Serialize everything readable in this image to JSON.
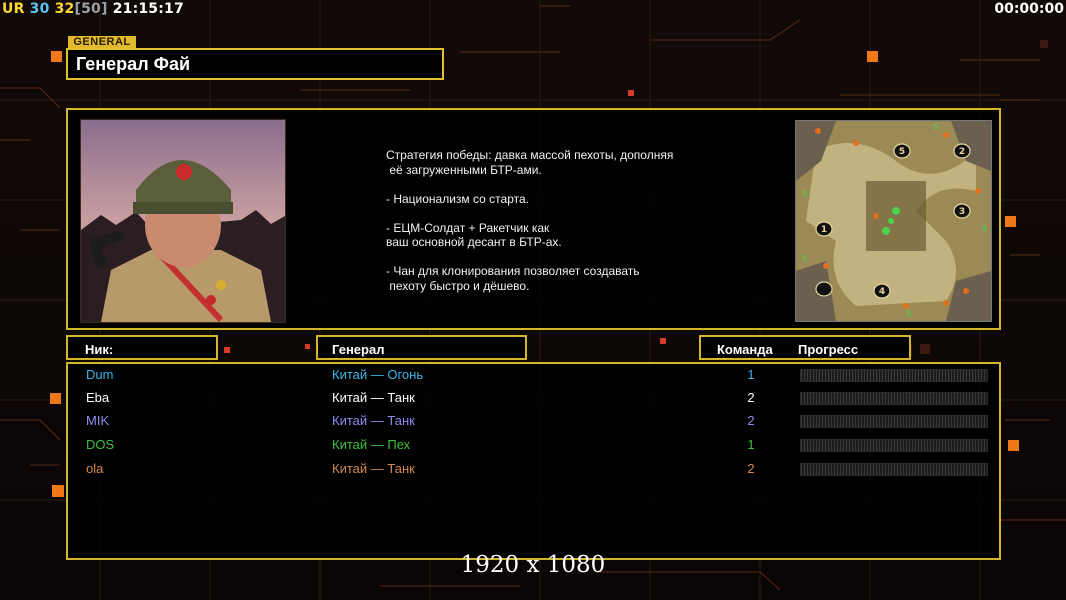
{
  "hud": {
    "ur": "UR",
    "fps": "30",
    "units": "32",
    "cap_open": "[",
    "cap": "50",
    "cap_close": "]",
    "clock": "21:15:17",
    "timer": "00:00:00"
  },
  "general": {
    "tag": "GENERAL",
    "name": "Генерал Фай"
  },
  "description": [
    "Стратегия победы: давка массой пехоты, дополняя",
    " её загруженными БТР-ами.",
    "",
    "- Национализм со старта.",
    "",
    "- ЕЦМ-Солдат + Ракетчик как",
    "ваш основной десант в БТР-ах.",
    "",
    "- Чан для клонирования позволяет создавать",
    " пехоту быстро и дёшево."
  ],
  "minimap": {
    "start_positions": [
      "5",
      "2",
      "3",
      "1",
      "4"
    ]
  },
  "columns": {
    "nick": "Ник:",
    "general": "Генерал",
    "team": "Команда",
    "progress": "Прогресс"
  },
  "players": [
    {
      "nick": "Dum",
      "general": "Китай — Огонь",
      "team": "1",
      "progress": 0,
      "color": "#3ab4e6"
    },
    {
      "nick": "Eba",
      "general": "Китай — Танк",
      "team": "2",
      "progress": 0,
      "color": "#ffffff"
    },
    {
      "nick": "MIK",
      "general": "Китай — Танк",
      "team": "2",
      "progress": 0,
      "color": "#8c8cf0"
    },
    {
      "nick": "DOS",
      "general": "Китай — Пех",
      "team": "1",
      "progress": 0,
      "color": "#3cc23c"
    },
    {
      "nick": "ola",
      "general": "Китай — Танк",
      "team": "2",
      "progress": 0,
      "color": "#d08a52"
    }
  ],
  "footer": {
    "resolution": "1920 x 1080"
  },
  "colors": {
    "frame": "#d4b62a",
    "accent_orange": "#f07a1a",
    "background": "#0d0807"
  }
}
